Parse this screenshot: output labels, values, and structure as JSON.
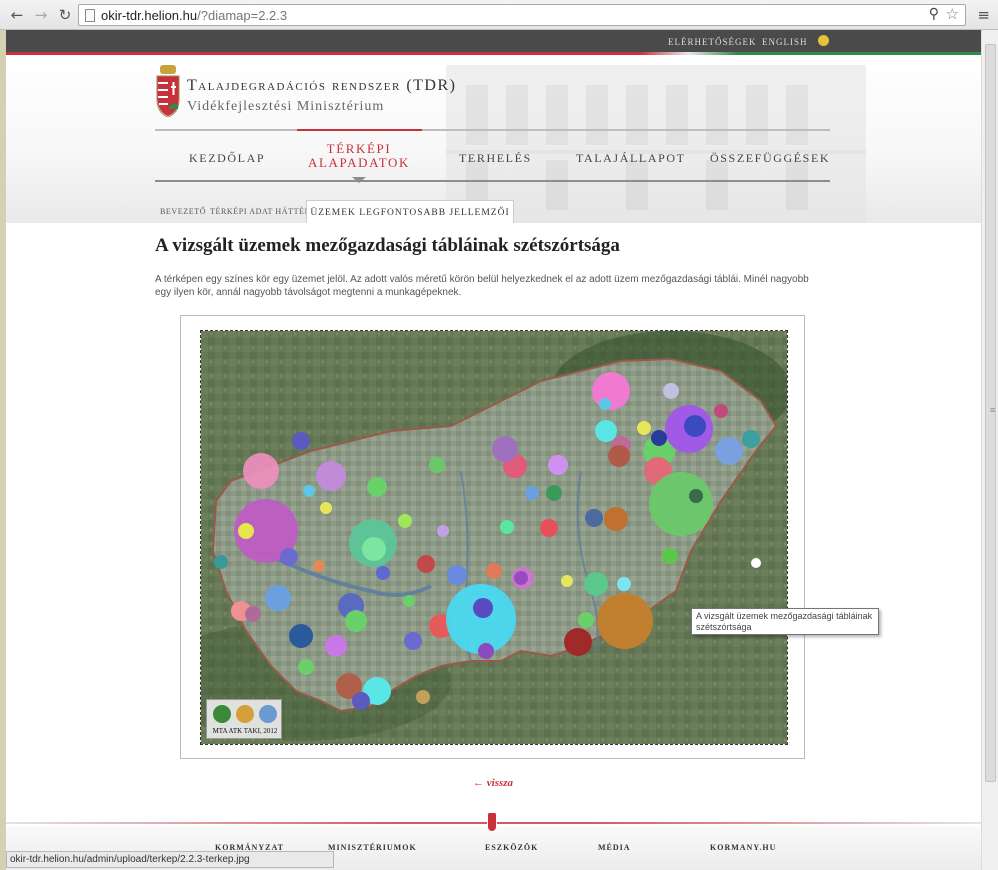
{
  "browser": {
    "url_host": "okir-tdr.helion.hu",
    "url_path": "/?diamap=2.2.3",
    "back_icon": "back-arrow-icon",
    "forward_icon": "forward-arrow-icon",
    "reload_icon": "reload-icon",
    "zoom_icon": "magnifier-icon",
    "star_icon": "bookmark-star-icon",
    "menu_icon": "hamburger-menu-icon"
  },
  "topbar": {
    "contact": "ELÉRHETŐSÉGEK",
    "english": "ENGLISH",
    "accessibility_icon": "accessibility-icon"
  },
  "header": {
    "title": "Talajdegradációs rendszer (TDR)",
    "subtitle": "Vidékfejlesztési Minisztérium"
  },
  "nav": {
    "items": [
      {
        "label": "Kezdőlap"
      },
      {
        "label": "Térképi alapadatok",
        "line1": "Térképi",
        "line2": "alapadatok",
        "active": true
      },
      {
        "label": "Terhelés"
      },
      {
        "label": "Talajállapot"
      },
      {
        "label": "Összefüggések"
      }
    ]
  },
  "subnav": {
    "items": [
      {
        "label": "Bevezető"
      },
      {
        "label": "Térképi adat háttér"
      },
      {
        "label": "Üzemek legfontosabb jellemzői",
        "active": true
      }
    ]
  },
  "content": {
    "heading": "A vizsgált üzemek mezőgazdasági tábláinak szétszórtsága",
    "intro": "A térképen egy színes kör egy üzemet jelöl. Az adott valós méretű körön belül helyezkednek el az adott üzem mezőgazdasági táblái. Minél nagyobb egy ilyen kör, annál nagyobb távolságot megtenni a munkagépeknek.",
    "map_credit": "MTA ATK TAKI, 2012",
    "tooltip": "A vizsgált üzemek mezőgazdasági tábláinak szétszórtsága",
    "back_link": "← vissza"
  },
  "footer": {
    "columns": [
      "Kormányzat",
      "Minisztériumok",
      "Eszközök",
      "Média",
      "Kormany.hu"
    ]
  },
  "status_bar": "okir-tdr.helion.hu/admin/upload/terkep/2.2.3-terkep.jpg",
  "colors": {
    "accent_red": "#c8313b",
    "topbar_gray": "#4a4a4a",
    "green": "#2f8a4b"
  }
}
